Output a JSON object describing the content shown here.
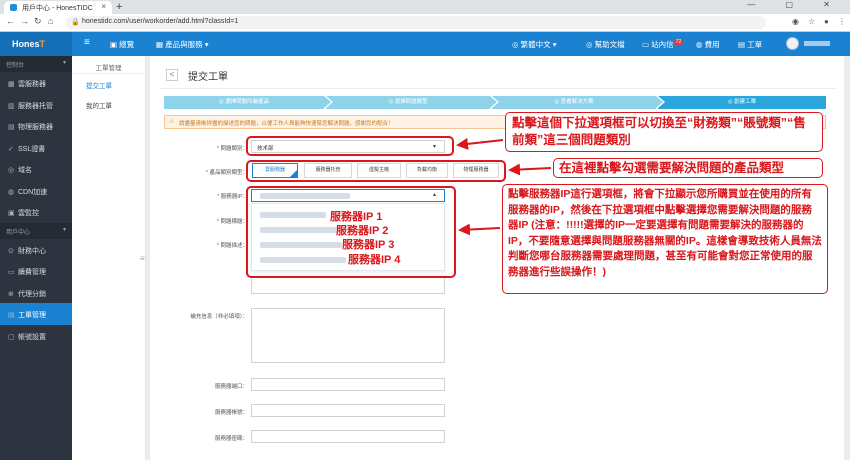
{
  "browser": {
    "tab_title": "用戶中心 - HonesTIDC",
    "url": "honestidc.com/user/workorder/add.html?classId=1",
    "new_tab_symbol": "+",
    "close_symbol": "×"
  },
  "topnav": {
    "logo_main": "Hones",
    "logo_accent": "T",
    "menu_toggle": "≡",
    "overview": "總覽",
    "products": "產品與服務",
    "language": "繁體中文",
    "help": "幫助文檔",
    "messages": "站內信",
    "message_count": "72",
    "billing": "費用",
    "tickets": "工單"
  },
  "sidebar": {
    "section_console": "控制台",
    "section_user": "用戶中心",
    "console_items": [
      {
        "label": "雲服務器",
        "icon": "server-icon",
        "glyph": "▦"
      },
      {
        "label": "服務器托管",
        "icon": "rack-icon",
        "glyph": "▥"
      },
      {
        "label": "物理服務器",
        "icon": "physical-server-icon",
        "glyph": "▤"
      },
      {
        "label": "SSL證書",
        "icon": "certificate-icon",
        "glyph": "✓"
      },
      {
        "label": "域名",
        "icon": "globe-icon",
        "glyph": "◎"
      },
      {
        "label": "CDN加速",
        "icon": "cdn-icon",
        "glyph": "◍"
      },
      {
        "label": "雲監控",
        "icon": "monitor-icon",
        "glyph": "▣"
      }
    ],
    "user_items": [
      {
        "label": "財務中心",
        "icon": "finance-icon",
        "glyph": "⊙"
      },
      {
        "label": "續費管理",
        "icon": "renew-icon",
        "glyph": "▭"
      },
      {
        "label": "代理分銷",
        "icon": "agent-icon",
        "glyph": "⊕"
      },
      {
        "label": "工單管理",
        "icon": "ticket-icon",
        "glyph": "▤",
        "active": true
      },
      {
        "label": "帳號設置",
        "icon": "account-icon",
        "glyph": "▢"
      }
    ]
  },
  "subnav": {
    "header": "工單管理",
    "items": [
      {
        "label": "提交工單",
        "active": true
      },
      {
        "label": "我的工單",
        "active": false
      }
    ]
  },
  "page": {
    "back_symbol": "<",
    "title": "提交工單",
    "steps": [
      "◎ 選擇問題所屬產品",
      "◎ 選擇問題類型",
      "◎ 查看解決方案",
      "◎ 創建工單"
    ],
    "warning": "請盡量清晰詳盡的描述您的問題，以便工作人員能夠快速幫您解決問題，感謝您的配合！",
    "labels": {
      "problem_type": "問題類別：",
      "product_type": "產品類別類型：",
      "server_ip": "服務器IP：",
      "title": "問題標題：",
      "description": "問題描述：",
      "supplement": "補充信息（非必填項）：",
      "port": "服務器端口：",
      "account": "服務器帳號：",
      "password": "服務器密碼："
    },
    "problem_type_value": "技术部",
    "product_tabs": [
      "雲服務器",
      "服務器托管",
      "虛擬主機",
      "負載均衡",
      "物理服務器"
    ],
    "ip_option_labels": [
      "服務器IP 1",
      "服務器IP 2",
      "服務器IP 3",
      "服務器IP 4"
    ]
  },
  "annotations": {
    "callout_1": "點擊這個下拉選項框可以切換至“財務類”“賬號類”“售前類”這三個問題類別",
    "callout_2": "在這裡點擊勾選需要解決問題的產品類型",
    "callout_3": "點擊服務器IP這行選項框，將會下拉顯示您所購買並在使用的所有服務器的IP，然後在下拉選項框中點擊選擇您需要解決問題的服務器IP (注意：!!!!!選擇的IP一定要選擇有問題需要解決的服務器的IP，不要隨意選擇與問題服務器無關的IP。這樣會導致技術人員無法判斷您哪台服務器需要處理問題，甚至有可能會對您正常使用的服務器進行些誤操作！)"
  },
  "colors": {
    "brand_blue": "#1b82d1",
    "annotation_red": "#d9171c",
    "sidebar_bg": "#2e3340"
  }
}
